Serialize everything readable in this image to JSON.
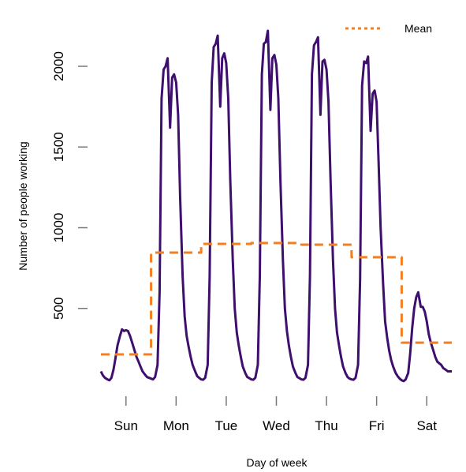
{
  "chart_data": {
    "type": "line",
    "title": "",
    "xlabel": "Day of week",
    "ylabel": "Number of people working",
    "x_unit": "days since start of Sunday",
    "xlim": [
      0,
      7
    ],
    "ylim": [
      0,
      2250
    ],
    "grid": false,
    "x_ticks": [
      {
        "value": 0.5,
        "label": "Sun"
      },
      {
        "value": 1.5,
        "label": "Mon"
      },
      {
        "value": 2.5,
        "label": "Tue"
      },
      {
        "value": 3.5,
        "label": "Wed"
      },
      {
        "value": 4.5,
        "label": "Thu"
      },
      {
        "value": 5.5,
        "label": "Fri"
      },
      {
        "value": 6.5,
        "label": "Sat"
      }
    ],
    "y_ticks": [
      {
        "value": 500,
        "label": "500"
      },
      {
        "value": 1000,
        "label": "1000"
      },
      {
        "value": 1500,
        "label": "1500"
      },
      {
        "value": 2000,
        "label": "2000"
      }
    ],
    "legend": {
      "position": "top-right",
      "entries": [
        {
          "label": "Mean",
          "style": "dashed",
          "color": "#F57F20"
        }
      ]
    },
    "series": [
      {
        "name": "People working",
        "color": "#3E0F6C",
        "style": "solid",
        "x": [
          0.0,
          0.04,
          0.08,
          0.13,
          0.17,
          0.21,
          0.25,
          0.29,
          0.33,
          0.38,
          0.42,
          0.46,
          0.5,
          0.54,
          0.58,
          0.63,
          0.67,
          0.71,
          0.75,
          0.79,
          0.83,
          0.88,
          0.92,
          0.96,
          1.0,
          1.04,
          1.08,
          1.13,
          1.17,
          1.21,
          1.25,
          1.29,
          1.33,
          1.38,
          1.42,
          1.46,
          1.5,
          1.54,
          1.58,
          1.63,
          1.67,
          1.71,
          1.75,
          1.79,
          1.83,
          1.88,
          1.92,
          1.96,
          2.0,
          2.04,
          2.08,
          2.13,
          2.17,
          2.21,
          2.25,
          2.29,
          2.33,
          2.38,
          2.42,
          2.46,
          2.5,
          2.54,
          2.58,
          2.63,
          2.67,
          2.71,
          2.75,
          2.79,
          2.83,
          2.88,
          2.92,
          2.96,
          3.0,
          3.04,
          3.08,
          3.13,
          3.17,
          3.21,
          3.25,
          3.29,
          3.33,
          3.38,
          3.42,
          3.46,
          3.5,
          3.54,
          3.58,
          3.63,
          3.67,
          3.71,
          3.75,
          3.79,
          3.83,
          3.88,
          3.92,
          3.96,
          4.0,
          4.04,
          4.08,
          4.13,
          4.17,
          4.21,
          4.25,
          4.29,
          4.33,
          4.38,
          4.42,
          4.46,
          4.5,
          4.54,
          4.58,
          4.63,
          4.67,
          4.71,
          4.75,
          4.79,
          4.83,
          4.88,
          4.92,
          4.96,
          5.0,
          5.04,
          5.08,
          5.13,
          5.17,
          5.21,
          5.25,
          5.29,
          5.33,
          5.38,
          5.42,
          5.46,
          5.5,
          5.54,
          5.58,
          5.63,
          5.67,
          5.71,
          5.75,
          5.79,
          5.83,
          5.88,
          5.92,
          5.96,
          6.0,
          6.04,
          6.08,
          6.13,
          6.17,
          6.21,
          6.25,
          6.29,
          6.33,
          6.38,
          6.42,
          6.46,
          6.5,
          6.54,
          6.58,
          6.63,
          6.67,
          6.71,
          6.75,
          6.79,
          6.83,
          6.88,
          6.92,
          6.96,
          7.0
        ],
        "values": [
          110,
          85,
          70,
          60,
          55,
          70,
          120,
          190,
          270,
          330,
          370,
          360,
          365,
          360,
          330,
          280,
          240,
          200,
          170,
          140,
          110,
          90,
          75,
          70,
          65,
          60,
          75,
          150,
          600,
          1800,
          1980,
          2000,
          2050,
          1620,
          1930,
          1950,
          1900,
          1700,
          1200,
          700,
          450,
          330,
          260,
          200,
          150,
          110,
          80,
          70,
          60,
          58,
          70,
          150,
          700,
          1900,
          2120,
          2140,
          2190,
          1750,
          2050,
          2080,
          2020,
          1800,
          1300,
          800,
          500,
          350,
          270,
          200,
          140,
          100,
          75,
          68,
          60,
          58,
          70,
          150,
          700,
          1950,
          2140,
          2150,
          2220,
          1730,
          2050,
          2070,
          2010,
          1800,
          1300,
          800,
          500,
          360,
          270,
          200,
          140,
          100,
          75,
          68,
          60,
          58,
          70,
          150,
          700,
          1950,
          2130,
          2150,
          2180,
          1700,
          2030,
          2040,
          1980,
          1780,
          1300,
          800,
          500,
          350,
          270,
          200,
          140,
          100,
          75,
          65,
          60,
          58,
          70,
          150,
          680,
          1880,
          2030,
          2020,
          2060,
          1600,
          1830,
          1850,
          1780,
          1400,
          1000,
          650,
          420,
          320,
          240,
          180,
          140,
          100,
          80,
          65,
          55,
          50,
          60,
          100,
          220,
          380,
          500,
          570,
          600,
          510,
          510,
          480,
          420,
          340,
          290,
          240,
          200,
          170,
          160,
          150,
          130,
          120,
          110,
          110,
          110
        ]
      },
      {
        "name": "Mean",
        "color": "#F57F20",
        "style": "dashed",
        "step": true,
        "x": [
          0,
          1,
          2,
          3,
          4,
          5,
          6,
          7
        ],
        "values": [
          215,
          846,
          900,
          905,
          895,
          817,
          288,
          288
        ]
      }
    ]
  }
}
